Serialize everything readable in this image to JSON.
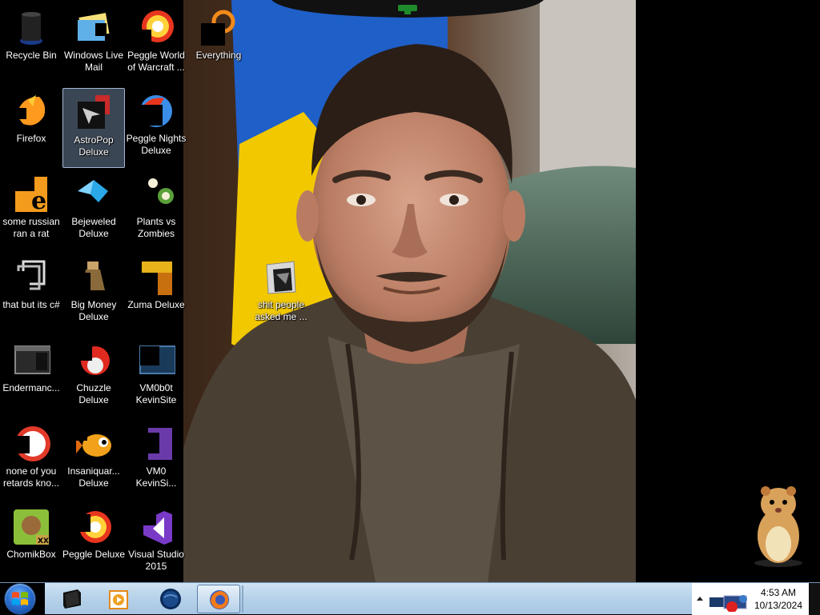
{
  "desktop": {
    "icons": [
      {
        "label": "Recycle Bin",
        "icon": "recycle-bin-icon"
      },
      {
        "label": "Windows Live\nMail",
        "icon": "windows-live-mail-icon"
      },
      {
        "label": "Peggle World\nof Warcraft ...",
        "icon": "peggle-world-of-warcraft-icon"
      },
      {
        "label": "Everything",
        "icon": "everything-search-icon"
      },
      {
        "label": "Firefox",
        "icon": "firefox-icon"
      },
      {
        "label": "AstroPop\nDeluxe",
        "icon": "astropop-deluxe-icon"
      },
      {
        "label": "Peggle Nights\nDeluxe",
        "icon": "peggle-nights-deluxe-icon"
      },
      {
        "label": "some russian\nran a rat",
        "icon": "java-file-icon"
      },
      {
        "label": "Bejeweled\nDeluxe",
        "icon": "bejeweled-deluxe-icon"
      },
      {
        "label": "Plants vs\nZombies",
        "icon": "plants-vs-zombies-icon"
      },
      {
        "label": "that but its c#",
        "icon": "shortcut-file-icon"
      },
      {
        "label": "Big Money\nDeluxe",
        "icon": "big-money-deluxe-icon"
      },
      {
        "label": "Zuma Deluxe",
        "icon": "zuma-deluxe-icon"
      },
      {
        "label": "Endermanc...",
        "icon": "endermanch-app-icon"
      },
      {
        "label": "Chuzzle\nDeluxe",
        "icon": "chuzzle-deluxe-icon"
      },
      {
        "label": "VM0b0t\nKevinSite",
        "icon": "vm0b0t-kevinsite-icon"
      },
      {
        "label": "none of you\nretards kno...",
        "icon": "none-of-you-app-icon"
      },
      {
        "label": "Insaniquar...\nDeluxe",
        "icon": "insaniquarium-deluxe-icon"
      },
      {
        "label": "VM0\nKevinSi...",
        "icon": "vm0-kevinsite-icon"
      },
      {
        "label": "ChomikBox",
        "icon": "chomikbox-icon"
      },
      {
        "label": "Peggle Deluxe",
        "icon": "peggle-deluxe-icon"
      },
      {
        "label": "Visual Studio\n2015",
        "icon": "visual-studio-2015-icon"
      },
      {
        "label": "shit people\nasked me ...",
        "icon": "folder-icon"
      }
    ],
    "selected_icon": "AstroPop Deluxe"
  },
  "taskbar": {
    "start_button": "windows-start-orb-icon",
    "pinned": [
      {
        "name": "command-prompt-icon",
        "active": false
      },
      {
        "name": "windows-media-player-icon",
        "active": false
      },
      {
        "name": "globe-browser-icon",
        "active": false
      },
      {
        "name": "firefox-icon",
        "active": true
      }
    ],
    "clock": {
      "time": "4:53 AM",
      "date": "10/13/2024"
    }
  },
  "colors": {
    "taskbar_top": "#cfe3f3",
    "taskbar_bottom": "#a7c6e3",
    "selection": "#aac8f0",
    "flag_blue": "#1f5fc8",
    "flag_yellow": "#f2c800"
  }
}
